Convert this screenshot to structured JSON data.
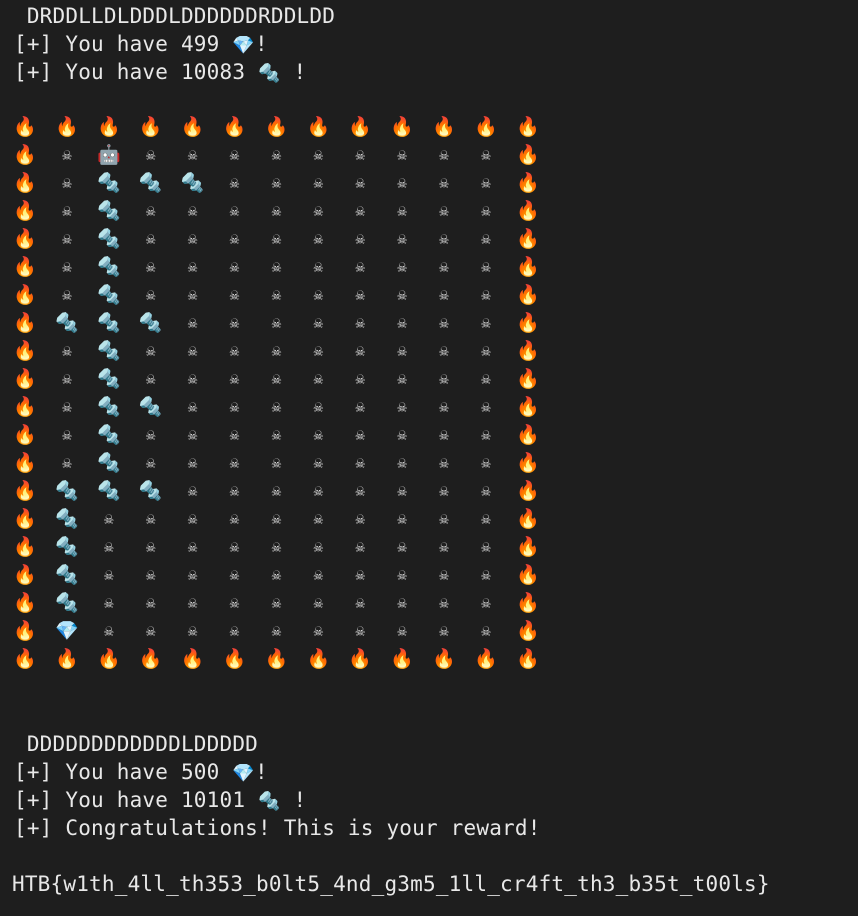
{
  "terminal": {
    "moves_1": " DRDDLLDLDDDLDDDDDDRDDLDD",
    "status_1": [
      {
        "prefix": "[+] You have 499 ",
        "icon": "💎",
        "suffix": "!"
      },
      {
        "prefix": "[+] You have 10083 ",
        "icon": "🔩",
        "suffix": " !"
      }
    ],
    "maze": {
      "rows": [
        [
          "🔥",
          "🔥",
          "🔥",
          "🔥",
          "🔥",
          "🔥",
          "🔥",
          "🔥",
          "🔥",
          "🔥",
          "🔥",
          "🔥",
          "🔥"
        ],
        [
          "🔥",
          "☠",
          "🤖",
          "☠",
          "☠",
          "☠",
          "☠",
          "☠",
          "☠",
          "☠",
          "☠",
          "☠",
          "🔥"
        ],
        [
          "🔥",
          "☠",
          "🔩",
          "🔩",
          "🔩",
          "☠",
          "☠",
          "☠",
          "☠",
          "☠",
          "☠",
          "☠",
          "🔥"
        ],
        [
          "🔥",
          "☠",
          "🔩",
          "☠",
          "☠",
          "☠",
          "☠",
          "☠",
          "☠",
          "☠",
          "☠",
          "☠",
          "🔥"
        ],
        [
          "🔥",
          "☠",
          "🔩",
          "☠",
          "☠",
          "☠",
          "☠",
          "☠",
          "☠",
          "☠",
          "☠",
          "☠",
          "🔥"
        ],
        [
          "🔥",
          "☠",
          "🔩",
          "☠",
          "☠",
          "☠",
          "☠",
          "☠",
          "☠",
          "☠",
          "☠",
          "☠",
          "🔥"
        ],
        [
          "🔥",
          "☠",
          "🔩",
          "☠",
          "☠",
          "☠",
          "☠",
          "☠",
          "☠",
          "☠",
          "☠",
          "☠",
          "🔥"
        ],
        [
          "🔥",
          "🔩",
          "🔩",
          "🔩",
          "☠",
          "☠",
          "☠",
          "☠",
          "☠",
          "☠",
          "☠",
          "☠",
          "🔥"
        ],
        [
          "🔥",
          "☠",
          "🔩",
          "☠",
          "☠",
          "☠",
          "☠",
          "☠",
          "☠",
          "☠",
          "☠",
          "☠",
          "🔥"
        ],
        [
          "🔥",
          "☠",
          "🔩",
          "☠",
          "☠",
          "☠",
          "☠",
          "☠",
          "☠",
          "☠",
          "☠",
          "☠",
          "🔥"
        ],
        [
          "🔥",
          "☠",
          "🔩",
          "🔩",
          "☠",
          "☠",
          "☠",
          "☠",
          "☠",
          "☠",
          "☠",
          "☠",
          "🔥"
        ],
        [
          "🔥",
          "☠",
          "🔩",
          "☠",
          "☠",
          "☠",
          "☠",
          "☠",
          "☠",
          "☠",
          "☠",
          "☠",
          "🔥"
        ],
        [
          "🔥",
          "☠",
          "🔩",
          "☠",
          "☠",
          "☠",
          "☠",
          "☠",
          "☠",
          "☠",
          "☠",
          "☠",
          "🔥"
        ],
        [
          "🔥",
          "🔩",
          "🔩",
          "🔩",
          "☠",
          "☠",
          "☠",
          "☠",
          "☠",
          "☠",
          "☠",
          "☠",
          "🔥"
        ],
        [
          "🔥",
          "🔩",
          "☠",
          "☠",
          "☠",
          "☠",
          "☠",
          "☠",
          "☠",
          "☠",
          "☠",
          "☠",
          "🔥"
        ],
        [
          "🔥",
          "🔩",
          "☠",
          "☠",
          "☠",
          "☠",
          "☠",
          "☠",
          "☠",
          "☠",
          "☠",
          "☠",
          "🔥"
        ],
        [
          "🔥",
          "🔩",
          "☠",
          "☠",
          "☠",
          "☠",
          "☠",
          "☠",
          "☠",
          "☠",
          "☠",
          "☠",
          "🔥"
        ],
        [
          "🔥",
          "🔩",
          "☠",
          "☠",
          "☠",
          "☠",
          "☠",
          "☠",
          "☠",
          "☠",
          "☠",
          "☠",
          "🔥"
        ],
        [
          "🔥",
          "💎",
          "☠",
          "☠",
          "☠",
          "☠",
          "☠",
          "☠",
          "☠",
          "☠",
          "☠",
          "☠",
          "🔥"
        ],
        [
          "🔥",
          "🔥",
          "🔥",
          "🔥",
          "🔥",
          "🔥",
          "🔥",
          "🔥",
          "🔥",
          "🔥",
          "🔥",
          "🔥",
          "🔥"
        ]
      ],
      "legend": {
        "🔥": "fire-icon",
        "☠": "skull-icon",
        "🤖": "robot-icon",
        "🔩": "bolt-icon",
        "💎": "gem-icon"
      }
    },
    "moves_2": " DDDDDDDDDDDDLDDDDD",
    "status_2": [
      {
        "prefix": "[+] You have 500 ",
        "icon": "💎",
        "suffix": "!"
      },
      {
        "prefix": "[+] You have 10101 ",
        "icon": "🔩",
        "suffix": " !"
      }
    ],
    "congrats": "[+] Congratulations! This is your reward!",
    "flag": "HTB{w1th_4ll_th353_b0lt5_4nd_g3m5_1ll_cr4ft_th3_b35t_t00ls}",
    "colors": {
      "background": "#1e1e1e",
      "text": "#e8e8e8"
    }
  }
}
